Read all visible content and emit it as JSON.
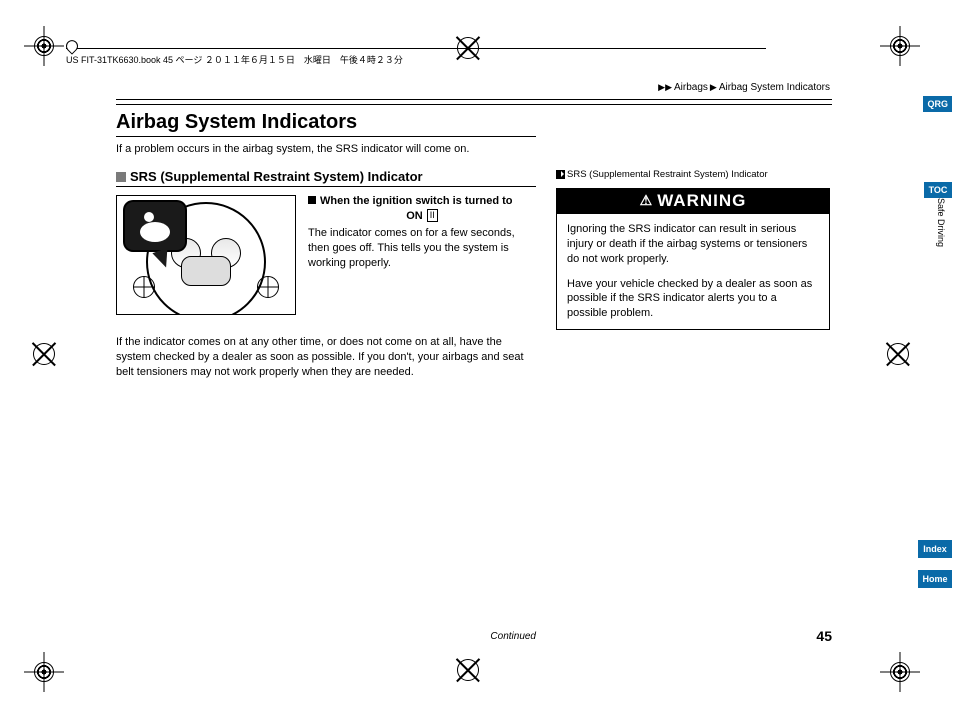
{
  "header_strip": "US FIT-31TK6630.book  45 ページ  ２０１１年６月１５日　水曜日　午後４時２３分",
  "breadcrumb": {
    "arrows": "▶▶",
    "part1": "Airbags",
    "sep": "▶",
    "part2": "Airbag System Indicators"
  },
  "title": "Airbag System Indicators",
  "intro": "If a problem occurs in the airbag system, the SRS indicator will come on.",
  "subheading": "SRS (Supplemental Restraint System) Indicator",
  "ignition": {
    "line1": "When the ignition switch is turned to",
    "on_label": "ON",
    "on_roman": "II",
    "body": "The indicator comes on for a few seconds, then goes off. This tells you the system is working properly."
  },
  "note": "If the indicator comes on at any other time, or does not come on at all, have the system checked by a dealer as soon as possible. If you don't, your airbags and seat belt tensioners may not work properly when they are needed.",
  "sidebar_ref": "SRS (Supplemental Restraint System) Indicator",
  "warning": {
    "title": "WARNING",
    "p1": "Ignoring the SRS indicator can result in serious injury or death if the airbag systems or tensioners do not work properly.",
    "p2": "Have your vehicle checked by a dealer as soon as possible if the SRS indicator alerts you to a possible problem."
  },
  "continued": "Continued",
  "page_number": "45",
  "nav": {
    "qrg": "QRG",
    "toc": "TOC",
    "section": "Safe Driving",
    "index": "Index",
    "home": "Home"
  }
}
